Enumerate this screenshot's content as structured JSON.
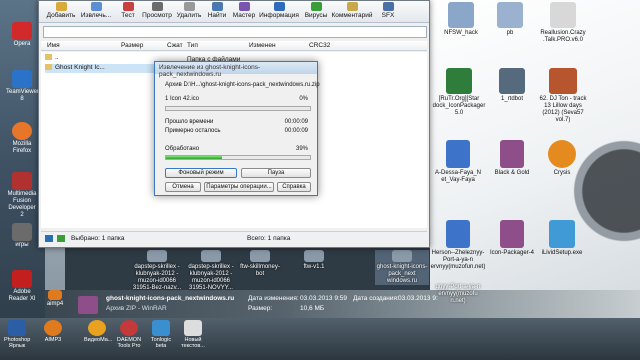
{
  "archiver": {
    "toolbar": [
      {
        "label": "Добавить",
        "icon": "add-icon",
        "color": "#d9a93b"
      },
      {
        "label": "Извлечь...",
        "icon": "extract-icon",
        "color": "#5b8fd1"
      },
      {
        "label": "Тест",
        "icon": "test-icon",
        "color": "#c94040"
      },
      {
        "label": "Просмотр",
        "icon": "view-icon",
        "color": "#6b6b6b"
      },
      {
        "label": "Удалить",
        "icon": "delete-icon",
        "color": "#999999"
      },
      {
        "label": "Найти",
        "icon": "find-icon",
        "color": "#4b78b0"
      },
      {
        "label": "Мастер",
        "icon": "wizard-icon",
        "color": "#7a55b0"
      },
      {
        "label": "Информация",
        "icon": "info-icon",
        "color": "#2f6bbd"
      },
      {
        "label": "Вирусы",
        "icon": "virus-icon",
        "color": "#3a9d3a"
      },
      {
        "label": "Комментарий",
        "icon": "comment-icon",
        "color": "#c9a84a"
      },
      {
        "label": "SFX",
        "icon": "sfx-icon",
        "color": "#4a6fa5"
      }
    ],
    "columns": {
      "name": "Имя",
      "size": "Размер",
      "packed": "Сжат",
      "type": "Тип",
      "modified": "Изменен",
      "crc": "CRC32"
    },
    "path_up": "..",
    "type_folder": "Папка с файлами",
    "rows": [
      "Ghost Knight Ic..."
    ],
    "status": {
      "left": "Выбрано: 1 папка",
      "right": "Всего: 1 папка"
    }
  },
  "progress": {
    "title": "Извлечение из ghost-knight-icons-pack_nextwindows.ru",
    "archive_line": "Архив D:\\Н...\\ghost-knight-icons-pack_nextwindows.ru.zip",
    "file_line": "1 Icon 42.ico",
    "file_percent": "0%",
    "elapsed_label": "Прошло времени",
    "elapsed": "00:00:09",
    "remaining_label": "Примерно осталось",
    "remaining": "00:00:09",
    "processed_label": "Обработано",
    "processed_percent": "39%",
    "processed_fraction": 0.39,
    "buttons": {
      "background": "Фоновый режим",
      "pause": "Пауза",
      "cancel": "Отмена",
      "params": "Параметры операции...",
      "help": "Справка"
    }
  },
  "desktop_right": [
    {
      "label": "NFSW_hack",
      "color": "#8aa6c8"
    },
    {
      "label": "pb",
      "color": "#9ab2cf"
    },
    {
      "label": "Reallusion.Crazy .Talk.PRO.v6.0",
      "color": "#d8d8d8"
    },
    {
      "label": "[RuTr.Org][Star dock_IconPackager 5.0",
      "color": "#2f7d3a"
    },
    {
      "label": "1_rtdbot",
      "color": "#556a7c"
    },
    {
      "label": "62. DJ Ton - track 13 Lillow days (2012) (Seva57 vol.7)",
      "color": "#b7552f"
    },
    {
      "label": "A-Dessa-Faya_N et_Vay-Faya",
      "color": "#3d74c9"
    },
    {
      "label": "Black & Gold",
      "color": "#8d4e8a"
    },
    {
      "label": "Crysis",
      "color": "#e58a1f"
    },
    {
      "label": "Herson--Zheleznyy-Port-a-ya-n ervnyy(muzofun.net)",
      "color": "#3d74c9"
    },
    {
      "label": "Icon-Packager-4",
      "color": "#8d4e8a"
    },
    {
      "label": "iLividSetup.exe",
      "color": "#3f9ad6"
    }
  ],
  "desktop_bottom": [
    {
      "label": "dapstep-skrillex -klubnyak-2012 -muzon-id0066 31951-Bez-nazv...",
      "color": "#8a9aa8"
    },
    {
      "label": "dapstep-skrillex -klubnyak-2012 -muzon-id0066 31951-NOVYY...",
      "color": "#8a9aa8"
    },
    {
      "label": "ftw-skillmoney-bot",
      "color": "#8a9aa8"
    },
    {
      "label": "ftw-v1.1",
      "color": "#8a9aa8"
    },
    {
      "label": "ghost-knight-icons-pack_next windows.ru",
      "color": "#8a9aa8"
    },
    {
      "label": "qnyy-Port-a-ya-n ervnyy(muzofu n.net)",
      "color": "#8a9aa8"
    }
  ],
  "info_panel": {
    "name": "ghost-knight-icons-pack_nextwindows.ru",
    "subtitle": "Архив ZIP - WinRAR",
    "modified_label": "Дата изменения:",
    "modified": "03.03.2013 9:59",
    "size_label": "Размер:",
    "size": "10,6 МБ",
    "created_label": "Дата создания:",
    "created": "03.03.2013 9:59"
  },
  "sidebar": [
    {
      "label": "Opera",
      "color": "#d22a2a"
    },
    {
      "label": "TeamViewer 8",
      "color": "#2a73c9"
    },
    {
      "label": "Mozilla Firefox",
      "color": "#e8762a"
    },
    {
      "label": "Multimedia Fusion Developer 2",
      "color": "#b13030"
    },
    {
      "label": "игры",
      "color": "#6b6b6b"
    },
    {
      "label": "Adobe Reader XI",
      "color": "#c41f1f"
    },
    {
      "label": "aimp4",
      "color": "#e07a1f"
    }
  ],
  "taskbar": [
    {
      "label": "Photoshop Ярлык",
      "color": "#2a5fa8"
    },
    {
      "label": "AIMP3",
      "color": "#e07a1f"
    },
    {
      "label": "ВидеоМа...",
      "color": "#e8a21f"
    },
    {
      "label": "DAEMON Tools Pro",
      "color": "#c43a3a"
    },
    {
      "label": "Tonlogic beta",
      "color": "#3a8fd1"
    },
    {
      "label": "Новый текстов...",
      "color": "#dddddd"
    }
  ]
}
